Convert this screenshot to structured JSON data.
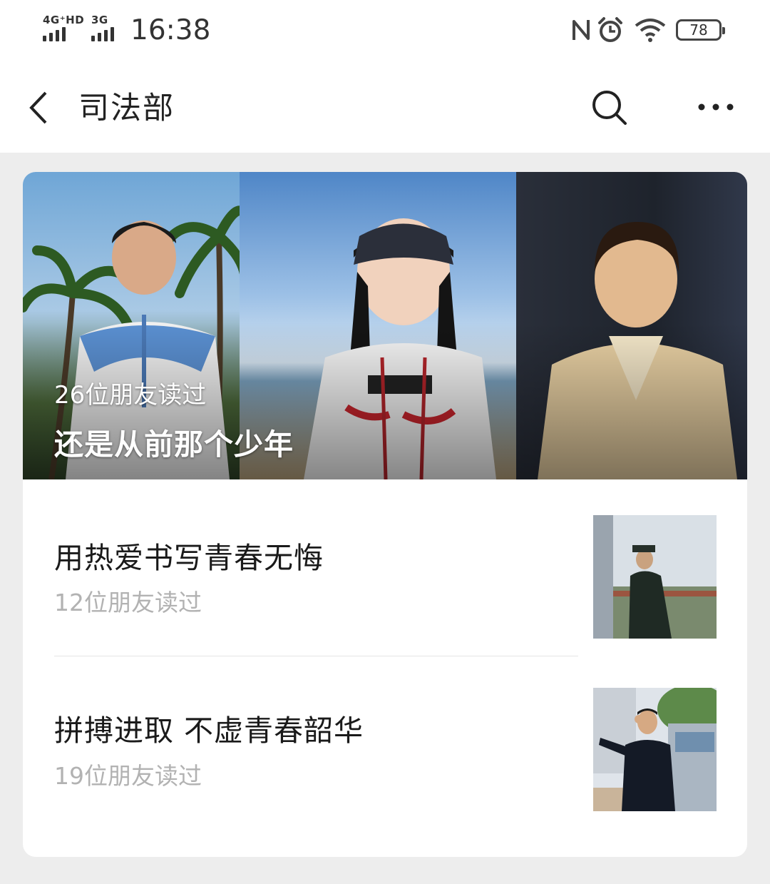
{
  "status_bar": {
    "network_1": "4G⁺HD",
    "network_2": "3G",
    "time": "16:38",
    "battery": "78",
    "icons": [
      "nfc-icon",
      "alarm-icon",
      "wifi-icon",
      "battery-icon"
    ]
  },
  "nav": {
    "title": "司法部",
    "icons": [
      "back-arrow-icon",
      "search-icon",
      "more-icon"
    ]
  },
  "hero": {
    "reads": "26位朋友读过",
    "title": "还是从前那个少年"
  },
  "articles": [
    {
      "title": "用热爱书写青春无悔",
      "reads": "12位朋友读过"
    },
    {
      "title": "拼搏进取 不虚青春韶华",
      "reads": "19位朋友读过"
    }
  ],
  "colors": {
    "page_bg": "#ededed",
    "card_bg": "#ffffff",
    "secondary_text": "#b2b2b2"
  }
}
